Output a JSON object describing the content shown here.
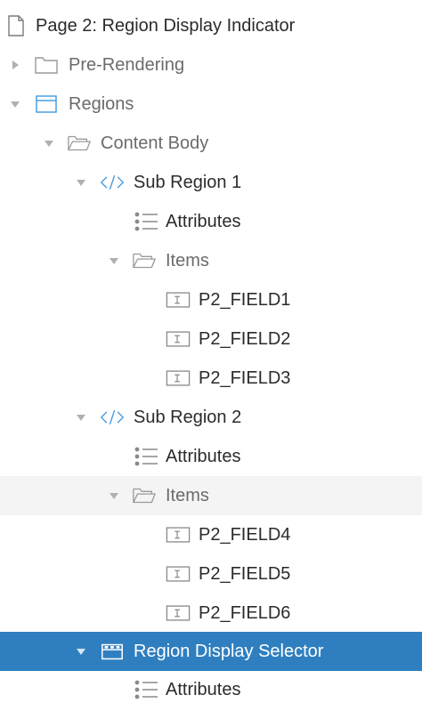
{
  "tree": {
    "page": {
      "label": "Page 2: Region Display Indicator",
      "icon": "page-icon"
    },
    "pre_rendering": {
      "label": "Pre-Rendering",
      "icon": "folder-icon"
    },
    "regions": {
      "label": "Regions",
      "icon": "region-icon"
    },
    "content_body": {
      "label": "Content Body",
      "icon": "folder-open-icon"
    },
    "sub_region_1": {
      "label": "Sub Region 1",
      "icon": "code-icon",
      "attributes": "Attributes",
      "items_label": "Items",
      "fields": [
        "P2_FIELD1",
        "P2_FIELD2",
        "P2_FIELD3"
      ]
    },
    "sub_region_2": {
      "label": "Sub Region 2",
      "icon": "code-icon",
      "attributes": "Attributes",
      "items_label": "Items",
      "fields": [
        "P2_FIELD4",
        "P2_FIELD5",
        "P2_FIELD6"
      ]
    },
    "region_display_selector": {
      "label": "Region Display Selector",
      "icon": "region-selector-icon",
      "attributes": "Attributes"
    }
  },
  "colors": {
    "selected_bg": "#2f7fc0",
    "hover_bg": "#f4f4f4",
    "accent": "#4a9de0"
  }
}
